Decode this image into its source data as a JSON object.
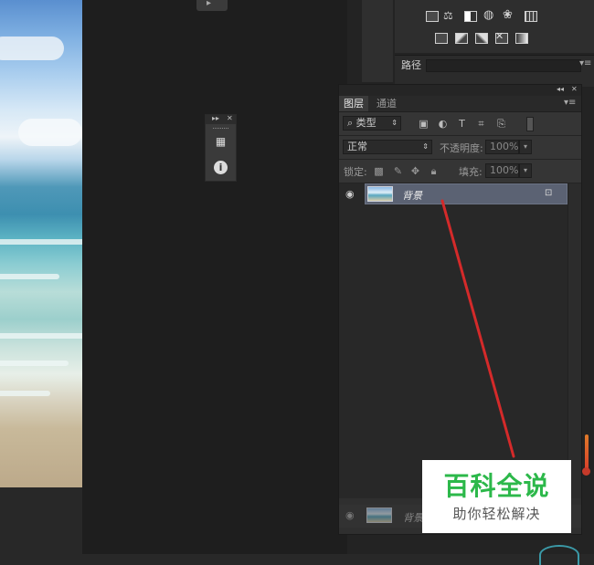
{
  "adjustments_panel": {
    "icon_row1": [
      "levels-icon",
      "balance-icon",
      "black-white-icon",
      "photo-filter-icon",
      "channel-mixer-icon",
      "color-lookup-icon"
    ],
    "icon_row2": [
      "invert-icon",
      "posterize-icon",
      "threshold-icon",
      "selective-color-icon",
      "gradient-map-icon"
    ]
  },
  "paths_panel": {
    "tab_label": "路径"
  },
  "mini_panel": {
    "icons": [
      "adjustment-presets-icon",
      "info-icon"
    ]
  },
  "layers_panel": {
    "tabs": [
      {
        "label": "图层",
        "active": true
      },
      {
        "label": "通道",
        "active": false
      }
    ],
    "filter": {
      "kind_label": "类型"
    },
    "blend_mode": "正常",
    "opacity_label": "不透明度:",
    "opacity_value": "100%",
    "lock_label": "锁定:",
    "fill_label": "填充:",
    "fill_value": "100%",
    "layers": [
      {
        "name": "背景",
        "visible": true,
        "locked": true,
        "selected": true
      }
    ],
    "dragging_layer_name": "背景"
  },
  "watermark": {
    "title": "百科全说",
    "subtitle": "助你轻松解决"
  },
  "colors": {
    "selected_layer": "#5b6273",
    "annotation_arrow": "#d42a2a",
    "watermark_green": "#2cb84a"
  }
}
